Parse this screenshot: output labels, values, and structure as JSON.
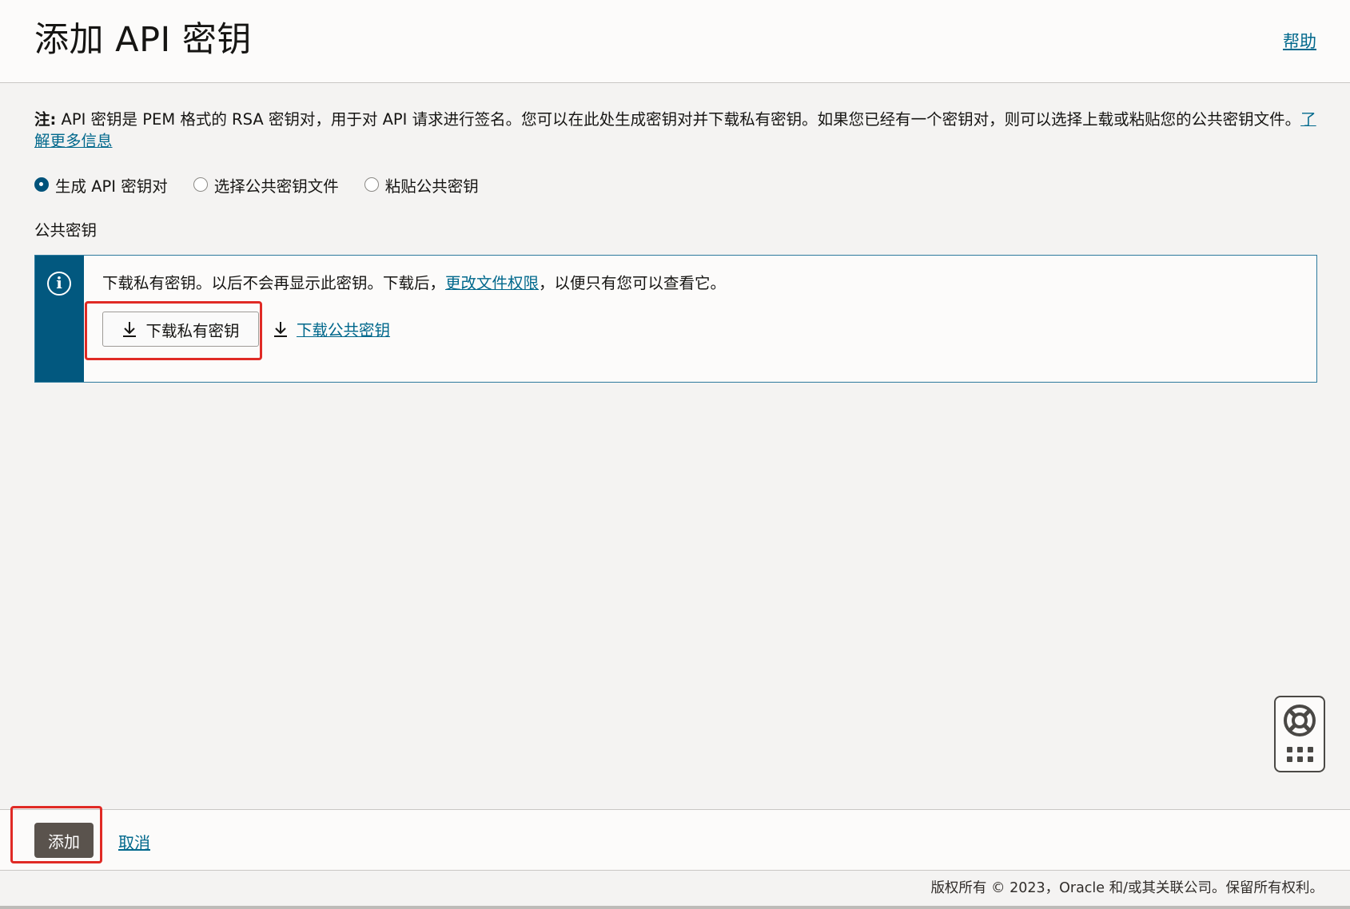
{
  "header": {
    "title": "添加 API 密钥",
    "help_link": "帮助"
  },
  "note": {
    "label": "注:",
    "text": " API 密钥是 PEM 格式的 RSA 密钥对，用于对 API 请求进行签名。您可以在此处生成密钥对并下载私有密钥。如果您已经有一个密钥对，则可以选择上载或粘贴您的公共密钥文件。",
    "learn_more": "了解更多信息"
  },
  "options": {
    "generate": "生成 API 密钥对",
    "choose_file": "选择公共密钥文件",
    "paste": "粘贴公共密钥",
    "selected": "generate"
  },
  "public_key": {
    "label": "公共密钥",
    "info_text_before": "下载私有密钥。以后不会再显示此密钥。下载后，",
    "info_link": "更改文件权限",
    "info_text_after": "，以便只有您可以查看它。",
    "download_private": "下载私有密钥",
    "download_public": "下载公共密钥"
  },
  "actions": {
    "add": "添加",
    "cancel": "取消"
  },
  "footer": {
    "copyright": "版权所有 © 2023，Oracle 和/或其关联公司。保留所有权利。"
  },
  "colors": {
    "link": "#00688c",
    "info_stripe": "#02587f",
    "primary_button": "#5a534d",
    "highlight": "#e02a25"
  }
}
